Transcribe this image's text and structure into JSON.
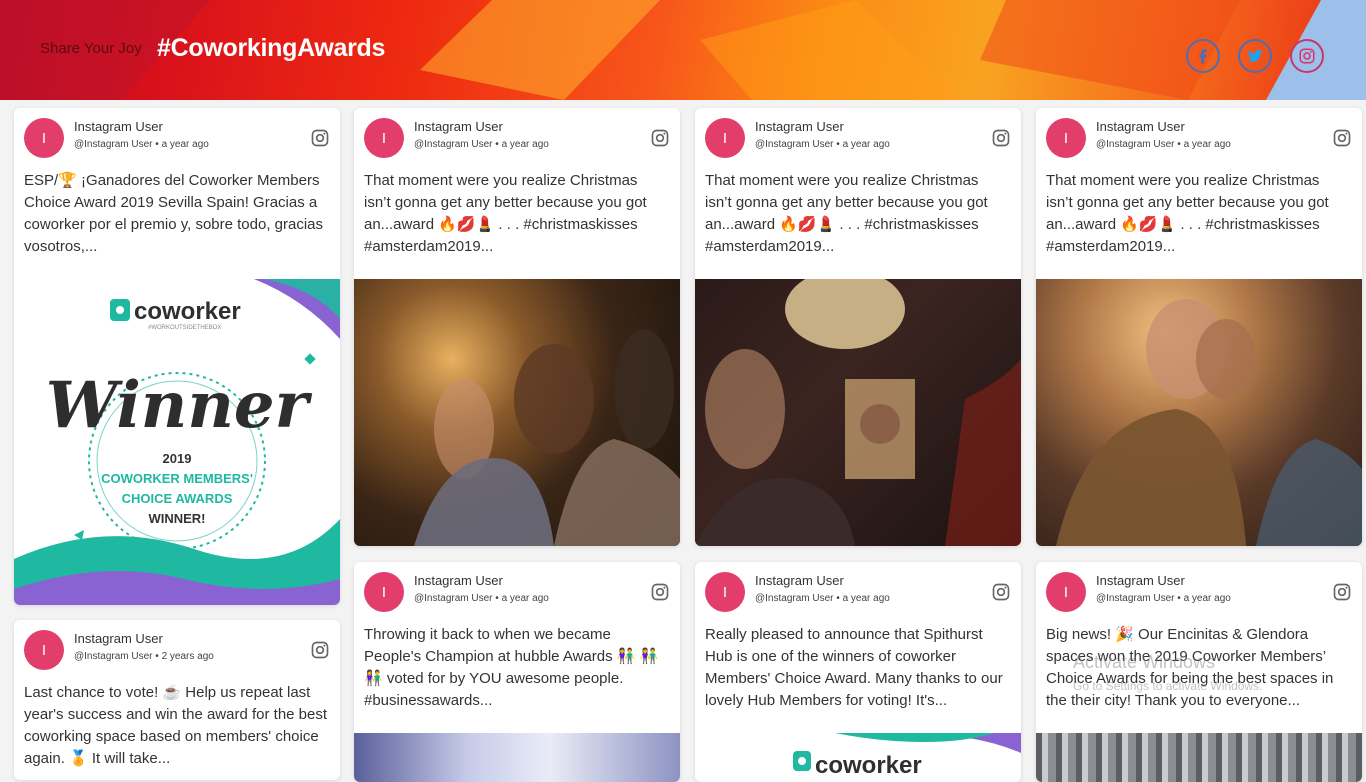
{
  "header": {
    "share_label": "Share Your Joy",
    "hashtag": "#CoworkingAwards",
    "social": [
      {
        "name": "facebook",
        "icon": "facebook-icon",
        "color": "#4b6fb3"
      },
      {
        "name": "twitter",
        "icon": "twitter-icon",
        "color": "#1da1f2"
      },
      {
        "name": "instagram",
        "icon": "instagram-icon",
        "color": "#e1306c"
      }
    ]
  },
  "cards": [
    {
      "avatar": "I",
      "user": "Instagram User",
      "meta": "@Instagram User • a year ago",
      "text": "ESP/🏆 ¡Ganadores del Coworker Members Choice Award 2019 Sevilla Spain! Gracias a coworker  por el premio y, sobre todo, gracias vosotros,...",
      "image": {
        "brand": "coworker",
        "tagline": "#WORKOUTSIDETHEBOX",
        "headline": "Winner",
        "year": "2019",
        "line1": "COWORKER MEMBERS'",
        "line2": "CHOICE AWARDS",
        "line3": "WINNER!"
      }
    },
    {
      "avatar": "I",
      "user": "Instagram User",
      "meta": "@Instagram User • a year ago",
      "text": "That moment were you realize Christmas isn’t gonna get any better because you got an...award 🔥💋💄 . . . #christmaskisses #amsterdam2019..."
    },
    {
      "avatar": "I",
      "user": "Instagram User",
      "meta": "@Instagram User • a year ago",
      "text": "That moment were you realize Christmas isn’t gonna get any better because you got an...award 🔥💋💄 . . . #christmaskisses #amsterdam2019..."
    },
    {
      "avatar": "I",
      "user": "Instagram User",
      "meta": "@Instagram User • a year ago",
      "text": "That moment were you realize Christmas isn’t gonna get any better because you got an...award 🔥💋💄 . . . #christmaskisses #amsterdam2019..."
    },
    {
      "avatar": "I",
      "user": "Instagram User",
      "meta": "@Instagram User • 2 years ago",
      "text": "Last chance to vote! ☕ Help us repeat last year's success and win the award for the best coworking space based on members' choice again. 🏅 It will take..."
    },
    {
      "avatar": "I",
      "user": "Instagram User",
      "meta": "@Instagram User • a year ago",
      "text": "Throwing it back to when we became People's Champion at hubble Awards 👫 👫👫 voted for by YOU awesome people. #businessawards..."
    },
    {
      "avatar": "I",
      "user": "Instagram User",
      "meta": "@Instagram User • a year ago",
      "text": "Really pleased to announce that Spithurst Hub is one of the winners of coworker Members' Choice Award. Many thanks to our lovely Hub Members for voting! It's...",
      "image": {
        "brand": "coworker"
      }
    },
    {
      "avatar": "I",
      "user": "Instagram User",
      "meta": "@Instagram User • a year ago",
      "text": "Big news! 🎉 Our Encinitas & Glendora spaces won the 2019 Coworker Members’ Choice Awards for being the best spaces in the their city! Thank you to everyone..."
    }
  ],
  "watermark": {
    "title": "Activate Windows",
    "subtitle": "Go to Settings to activate Windows."
  },
  "colors": {
    "avatar": "#e23d6b",
    "teal": "#1fb8a0",
    "purple": "#8a63d2"
  }
}
